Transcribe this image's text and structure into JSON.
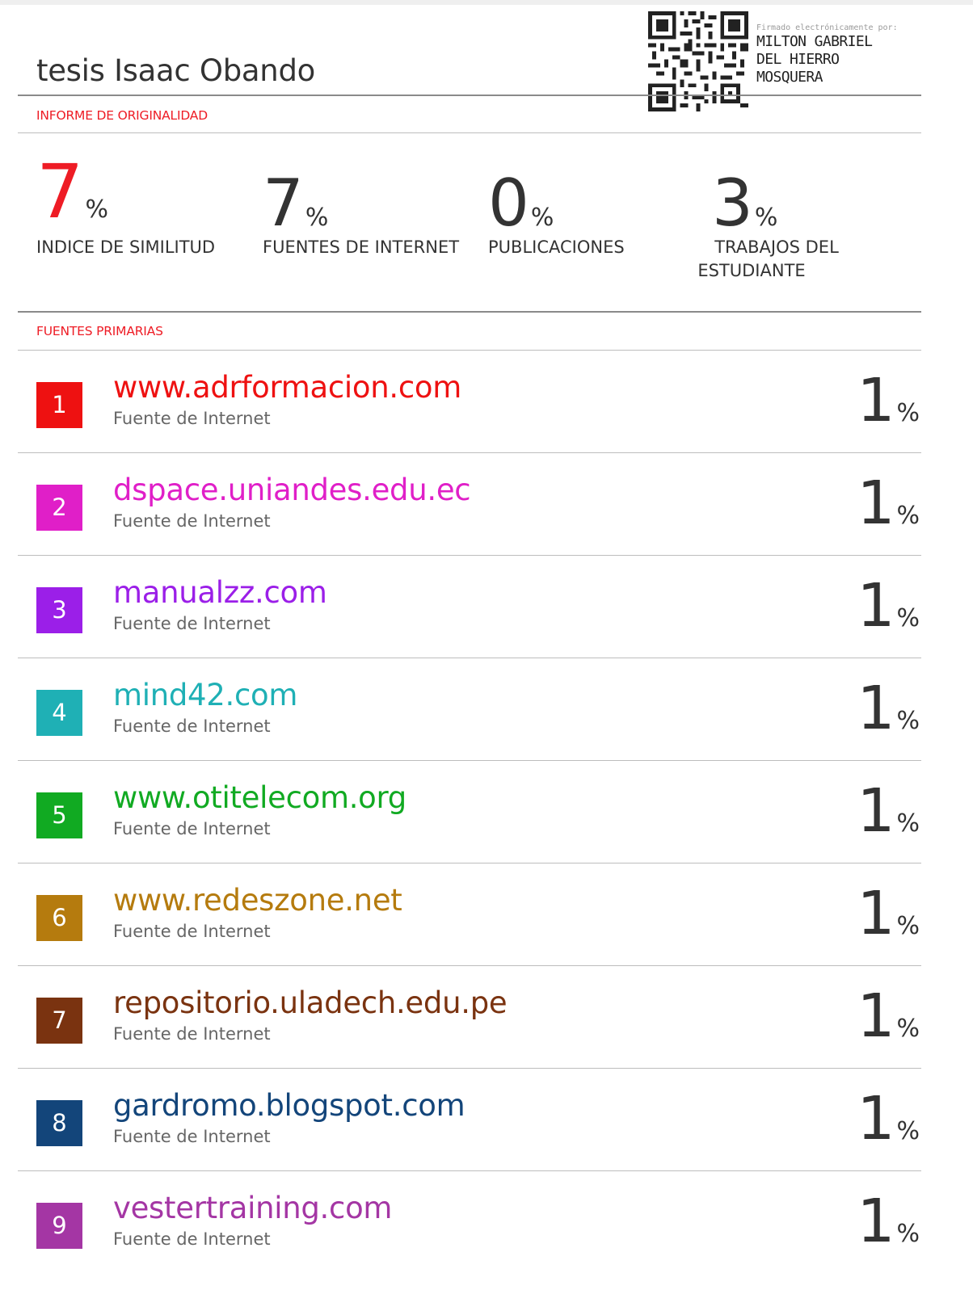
{
  "document": {
    "title": "tesis Isaac Obando",
    "signature": {
      "caption": "Firmado electrónicamente por:",
      "name_lines": [
        "MILTON GABRIEL",
        "DEL HIERRO",
        "MOSQUERA"
      ]
    }
  },
  "report": {
    "section_label": "INFORME DE ORIGINALIDAD",
    "stats": [
      {
        "value": "7",
        "unit": "%",
        "label": "INDICE DE SIMILITUD",
        "color": "#ee1c25"
      },
      {
        "value": "7",
        "unit": "%",
        "label": "FUENTES DE INTERNET",
        "color": "#333333"
      },
      {
        "value": "0",
        "unit": "%",
        "label": "PUBLICACIONES",
        "color": "#333333"
      },
      {
        "value": "3",
        "unit": "%",
        "label_lines": [
          "TRABAJOS DEL",
          "ESTUDIANTE"
        ],
        "color": "#333333"
      }
    ]
  },
  "sources": {
    "section_label": "FUENTES PRIMARIAS",
    "items": [
      {
        "rank": "1",
        "name": "www.adrformacion.com",
        "type": "Fuente de Internet",
        "percent": "1",
        "unit": "%",
        "color": "#ee1111"
      },
      {
        "rank": "2",
        "name": "dspace.uniandes.edu.ec",
        "type": "Fuente de Internet",
        "percent": "1",
        "unit": "%",
        "color": "#e01fc8"
      },
      {
        "rank": "3",
        "name": "manualzz.com",
        "type": "Fuente de Internet",
        "percent": "1",
        "unit": "%",
        "color": "#9b1fe8"
      },
      {
        "rank": "4",
        "name": "mind42.com",
        "type": "Fuente de Internet",
        "percent": "1",
        "unit": "%",
        "color": "#1fb0b5"
      },
      {
        "rank": "5",
        "name": "www.otitelecom.org",
        "type": "Fuente de Internet",
        "percent": "1",
        "unit": "%",
        "color": "#11aa22"
      },
      {
        "rank": "6",
        "name": "www.redeszone.net",
        "type": "Fuente de Internet",
        "percent": "1",
        "unit": "%",
        "color": "#b57b0e"
      },
      {
        "rank": "7",
        "name": "repositorio.uladech.edu.pe",
        "type": "Fuente de Internet",
        "percent": "1",
        "unit": "%",
        "color": "#7a3310"
      },
      {
        "rank": "8",
        "name": "gardromo.blogspot.com",
        "type": "Fuente de Internet",
        "percent": "1",
        "unit": "%",
        "color": "#13457a"
      },
      {
        "rank": "9",
        "name": "vestertraining.com",
        "type": "Fuente de Internet",
        "percent": "1",
        "unit": "%",
        "color": "#a436a4"
      }
    ]
  }
}
